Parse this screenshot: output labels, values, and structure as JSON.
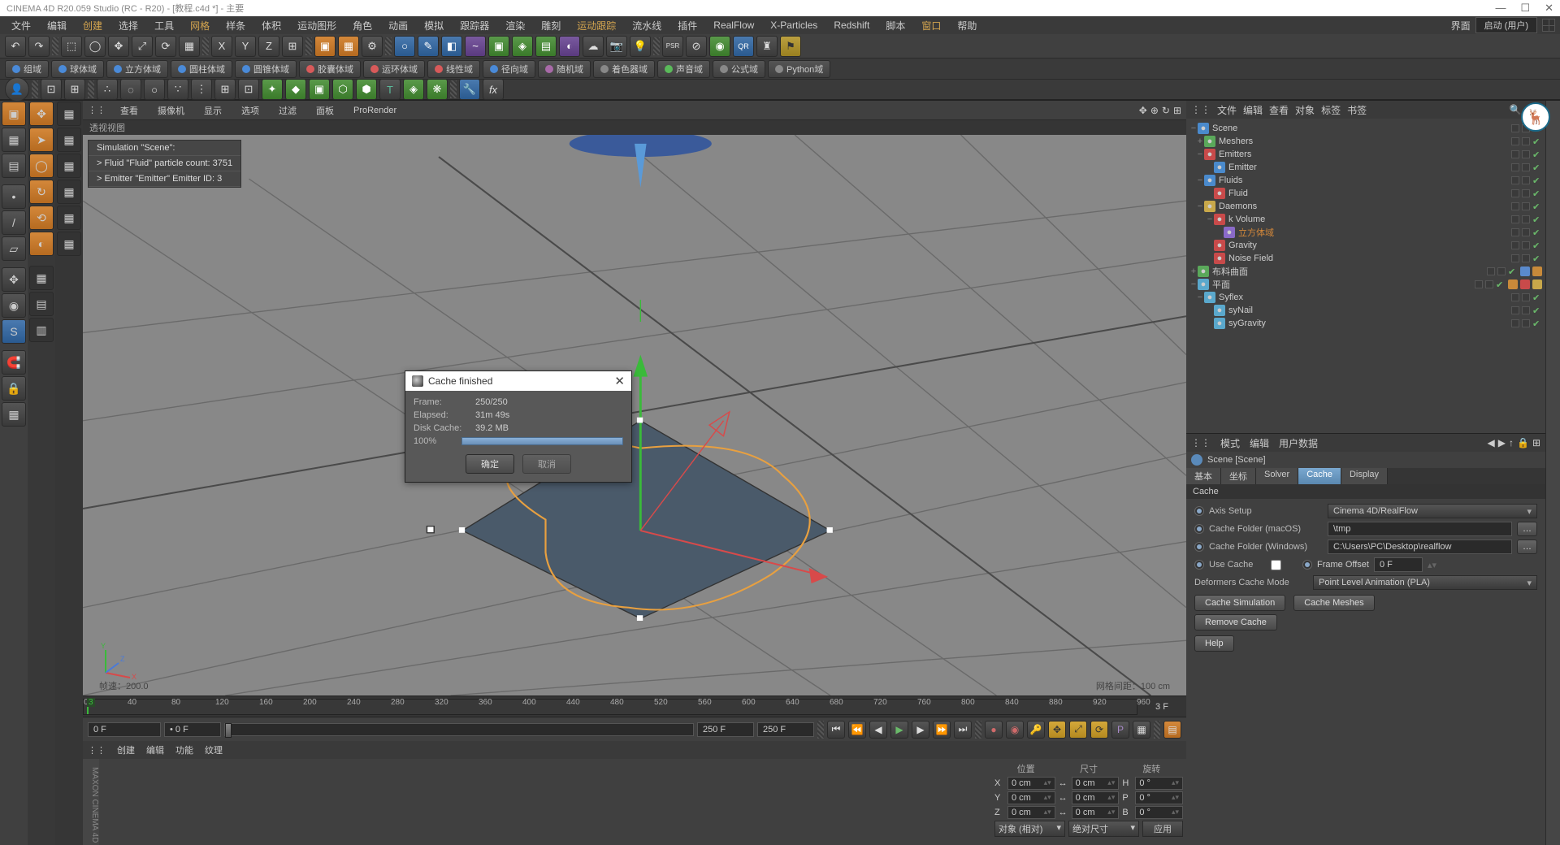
{
  "title": "CINEMA 4D R20.059 Studio (RC - R20) - [教程.c4d *] - 主要",
  "menubar": {
    "items": [
      "文件",
      "编辑",
      "创建",
      "选择",
      "工具",
      "网格",
      "样条",
      "体积",
      "运动图形",
      "角色",
      "动画",
      "模拟",
      "跟踪器",
      "渲染",
      "雕刻",
      "运动跟踪",
      "流水线",
      "插件",
      "RealFlow",
      "X-Particles",
      "Redshift",
      "脚本",
      "窗口",
      "帮助"
    ],
    "highlight_indices": [
      2,
      5,
      15,
      22
    ],
    "layout_label": "界面",
    "layout_value": "启动 (用户)"
  },
  "palette_row": [
    {
      "label": "组域",
      "color": "blue"
    },
    {
      "label": "球体域",
      "color": "blue"
    },
    {
      "label": "立方体域",
      "color": "blue"
    },
    {
      "label": "圆柱体域",
      "color": "blue"
    },
    {
      "label": "圆锥体域",
      "color": "blue"
    },
    {
      "label": "胶囊体域",
      "color": "red"
    },
    {
      "label": "运环体域",
      "color": "red"
    },
    {
      "label": "线性域",
      "color": "red"
    },
    {
      "label": "径向域",
      "color": "blue"
    },
    {
      "label": "随机域",
      "color": "plum"
    },
    {
      "label": "着色器域",
      "color": "grey"
    },
    {
      "label": "声音域",
      "color": "green"
    },
    {
      "label": "公式域",
      "color": "grey"
    },
    {
      "label": "Python域",
      "color": "grey"
    }
  ],
  "viewport": {
    "tabs": [
      "查看",
      "摄像机",
      "显示",
      "选项",
      "过滤",
      "面板",
      "ProRender"
    ],
    "title": "透视视图",
    "sim_info": [
      "Simulation \"Scene\":",
      "  > Fluid \"Fluid\" particle count: 3751",
      "  > Emitter \"Emitter\" Emitter ID: 3"
    ],
    "footer_left": "帧速：200.0",
    "footer_right": "网格间距：100 cm"
  },
  "dialog": {
    "title": "Cache finished",
    "rows": [
      {
        "label": "Frame:",
        "value": "250/250"
      },
      {
        "label": "Elapsed:",
        "value": "31m 49s"
      },
      {
        "label": "Disk Cache:",
        "value": "39.2 MB"
      },
      {
        "label": "100%",
        "value": ""
      }
    ],
    "ok": "确定",
    "cancel": "取消"
  },
  "objects_panel": {
    "menu": [
      "文件",
      "编辑",
      "查看",
      "对象",
      "标签",
      "书签"
    ],
    "tree": [
      {
        "name": "Scene",
        "indent": 0,
        "icon": "#4a8acc",
        "toggle": "−"
      },
      {
        "name": "Meshers",
        "indent": 1,
        "icon": "#5aa85a",
        "toggle": "+"
      },
      {
        "name": "Emitters",
        "indent": 1,
        "icon": "#c84a4a",
        "toggle": "−"
      },
      {
        "name": "Emitter",
        "indent": 2,
        "icon": "#4a8acc",
        "toggle": ""
      },
      {
        "name": "Fluids",
        "indent": 1,
        "icon": "#4a8acc",
        "toggle": "−"
      },
      {
        "name": "Fluid",
        "indent": 2,
        "icon": "#c84a4a",
        "toggle": ""
      },
      {
        "name": "Daemons",
        "indent": 1,
        "icon": "#c8a84a",
        "toggle": "−"
      },
      {
        "name": "k Volume",
        "indent": 2,
        "icon": "#c84a4a",
        "toggle": "−"
      },
      {
        "name": "立方体域",
        "indent": 3,
        "icon": "#8a6ac8",
        "toggle": "",
        "highlight": true
      },
      {
        "name": "Gravity",
        "indent": 2,
        "icon": "#c84a4a",
        "toggle": ""
      },
      {
        "name": "Noise Field",
        "indent": 2,
        "icon": "#c84a4a",
        "toggle": ""
      },
      {
        "name": "布料曲面",
        "indent": 0,
        "icon": "#5aa85a",
        "toggle": "+",
        "tags": [
          "#5a8acc",
          "#c88a3a"
        ]
      },
      {
        "name": "平面",
        "indent": 0,
        "icon": "#5aa8cc",
        "toggle": "−",
        "tags": [
          "#c88a3a",
          "#c84a4a",
          "#c8a84a"
        ]
      },
      {
        "name": "Syflex",
        "indent": 1,
        "icon": "#5aa8cc",
        "toggle": "−"
      },
      {
        "name": "syNail",
        "indent": 2,
        "icon": "#5aa8cc",
        "toggle": ""
      },
      {
        "name": "syGravity",
        "indent": 2,
        "icon": "#5aa8cc",
        "toggle": ""
      }
    ]
  },
  "attr_panel": {
    "menu": [
      "模式",
      "编辑",
      "用户数据"
    ],
    "head": "Scene [Scene]",
    "tabs": [
      "基本",
      "坐标",
      "Solver",
      "Cache",
      "Display"
    ],
    "active_tab": 3,
    "section": "Cache",
    "rows": {
      "axis_setup": {
        "label": "Axis Setup",
        "value": "Cinema 4D/RealFlow"
      },
      "folder_mac": {
        "label": "Cache Folder (macOS)",
        "value": "\\tmp"
      },
      "folder_win": {
        "label": "Cache Folder (Windows)",
        "value": "C:\\Users\\PC\\Desktop\\realflow"
      },
      "use_cache": {
        "label": "Use Cache",
        "checked": false
      },
      "frame_offset": {
        "label": "Frame Offset",
        "value": "0 F"
      },
      "deformers": {
        "label": "Deformers Cache Mode",
        "value": "Point Level Animation (PLA)"
      }
    },
    "buttons": [
      "Cache Simulation",
      "Cache Meshes",
      "Remove Cache",
      "Help"
    ]
  },
  "timeline": {
    "start": 0,
    "end": 960,
    "step": 40,
    "current_label": "3 F",
    "frame_start": "0 F",
    "frame_zero": "• 0 F",
    "frame_mid": "250 F",
    "frame_end": "250 F"
  },
  "bottom_tabs": [
    "创建",
    "编辑",
    "功能",
    "纹理"
  ],
  "coord": {
    "headers": [
      "位置",
      "尺寸",
      "旋转"
    ],
    "rows": [
      {
        "axis": "X",
        "pos": "0 cm",
        "size": "0 cm",
        "sizelbl": "H",
        "rot": "0 °"
      },
      {
        "axis": "Y",
        "pos": "0 cm",
        "size": "0 cm",
        "sizelbl": "P",
        "rot": "0 °"
      },
      {
        "axis": "Z",
        "pos": "0 cm",
        "size": "0 cm",
        "sizelbl": "B",
        "rot": "0 °"
      }
    ],
    "footer": {
      "m1": "对象 (相对)",
      "m2": "绝对尺寸",
      "apply": "应用"
    }
  },
  "side_label": "MAXON CINEMA 4D"
}
